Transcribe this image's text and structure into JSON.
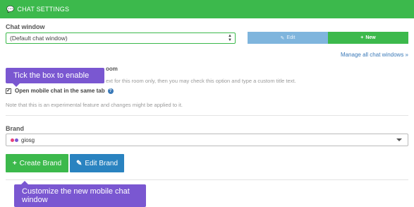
{
  "header": {
    "icon": "chat-bubble-icon",
    "title": "CHAT SETTINGS",
    "color": "#3cb94c"
  },
  "chat_window": {
    "label": "Chat window",
    "selected": "(Default chat window)",
    "edit_label": "Edit",
    "new_label": "New",
    "manage_link": "Manage all chat windows »"
  },
  "mobile": {
    "section_title_partial": "oom",
    "description_partial": "ext for this room only, then you may check this option and type a custom title text.",
    "checkbox_checked": true,
    "checkbox_label": "Open mobile chat in the same tab",
    "note": "Note that this is an experimental feature and changes might be applied to it."
  },
  "brand": {
    "label": "Brand",
    "selected": "giosg",
    "dot_colors": [
      "#e8407a",
      "#7a57d1"
    ],
    "create_label": "Create Brand",
    "edit_label": "Edit Brand"
  },
  "tooltips": {
    "checkbox_tip": "Tick the box to enable",
    "brand_tip": "Customize the new mobile chat window",
    "color": "#7a57d1"
  },
  "colors": {
    "green": "#3cb94c",
    "blue": "#2a83c0",
    "link": "#3a79b8"
  }
}
